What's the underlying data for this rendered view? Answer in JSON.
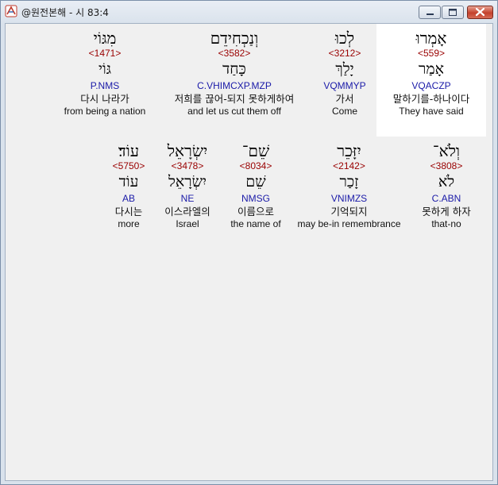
{
  "window": {
    "title": "@원전본해 - 시 83:4",
    "icon": "hebrew-bible-app-icon",
    "controls": [
      "minimize-icon",
      "maximize-icon",
      "close-icon"
    ]
  },
  "rows": [
    {
      "words": [
        {
          "hebrew": "מִגּוֹי",
          "strong": "<1471>",
          "lemma": "גּוֹי",
          "parse": "P.NMS",
          "korean": "다시 나라가",
          "english": "from being a nation"
        },
        {
          "hebrew": "וְנַכְחִידֵם",
          "strong": "<3582>",
          "lemma": "כָּחַד",
          "parse": "C.VHIMCXP.MZP",
          "korean": "저희를 끊어-되지 못하게하여",
          "english": "and let us cut them off"
        },
        {
          "hebrew": "לְכוּ",
          "strong": "<3212>",
          "lemma": "יָלַךְ",
          "parse": "VQMMYP",
          "korean": "가서",
          "english": "Come"
        },
        {
          "hebrew": "אָמְרוּ",
          "strong": "<559>",
          "lemma": "אָמַר",
          "parse": "VQACZP",
          "korean": "말하기를-하나이다",
          "english": "They have said",
          "selected": true
        }
      ]
    },
    {
      "words": [
        {
          "hebrew": "עוֹד׃",
          "strong": "<5750>",
          "lemma": "עוֹד",
          "parse": "AB",
          "korean": "다시는",
          "english": "more"
        },
        {
          "hebrew": "יִשְׂרָאֵל",
          "strong": "<3478>",
          "lemma": "יִשְׂרָאֵל",
          "parse": "NE",
          "korean": "이스라엘의",
          "english": "Israel"
        },
        {
          "hebrew": "שֵׁם־",
          "strong": "<8034>",
          "lemma": "שֵׁם",
          "parse": "NMSG",
          "korean": "이름으로",
          "english": "the name of"
        },
        {
          "hebrew": "יִזָּכֵר",
          "strong": "<2142>",
          "lemma": "זָכַר",
          "parse": "VNIMZS",
          "korean": "기억되지",
          "english": "may be-in remembrance"
        },
        {
          "hebrew": "וְלֹא־",
          "strong": "<3808>",
          "lemma": "לֹא",
          "parse": "C.ABN",
          "korean": "못하게 하자",
          "english": "that-no"
        }
      ]
    }
  ]
}
